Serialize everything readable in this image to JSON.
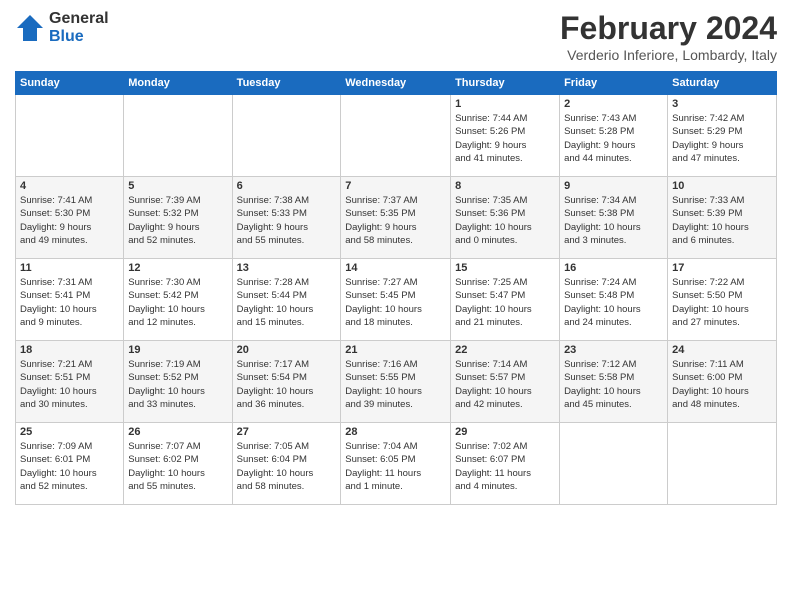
{
  "logo": {
    "general": "General",
    "blue": "Blue"
  },
  "title": "February 2024",
  "subtitle": "Verderio Inferiore, Lombardy, Italy",
  "headers": [
    "Sunday",
    "Monday",
    "Tuesday",
    "Wednesday",
    "Thursday",
    "Friday",
    "Saturday"
  ],
  "weeks": [
    [
      {
        "day": "",
        "info": ""
      },
      {
        "day": "",
        "info": ""
      },
      {
        "day": "",
        "info": ""
      },
      {
        "day": "",
        "info": ""
      },
      {
        "day": "1",
        "info": "Sunrise: 7:44 AM\nSunset: 5:26 PM\nDaylight: 9 hours\nand 41 minutes."
      },
      {
        "day": "2",
        "info": "Sunrise: 7:43 AM\nSunset: 5:28 PM\nDaylight: 9 hours\nand 44 minutes."
      },
      {
        "day": "3",
        "info": "Sunrise: 7:42 AM\nSunset: 5:29 PM\nDaylight: 9 hours\nand 47 minutes."
      }
    ],
    [
      {
        "day": "4",
        "info": "Sunrise: 7:41 AM\nSunset: 5:30 PM\nDaylight: 9 hours\nand 49 minutes."
      },
      {
        "day": "5",
        "info": "Sunrise: 7:39 AM\nSunset: 5:32 PM\nDaylight: 9 hours\nand 52 minutes."
      },
      {
        "day": "6",
        "info": "Sunrise: 7:38 AM\nSunset: 5:33 PM\nDaylight: 9 hours\nand 55 minutes."
      },
      {
        "day": "7",
        "info": "Sunrise: 7:37 AM\nSunset: 5:35 PM\nDaylight: 9 hours\nand 58 minutes."
      },
      {
        "day": "8",
        "info": "Sunrise: 7:35 AM\nSunset: 5:36 PM\nDaylight: 10 hours\nand 0 minutes."
      },
      {
        "day": "9",
        "info": "Sunrise: 7:34 AM\nSunset: 5:38 PM\nDaylight: 10 hours\nand 3 minutes."
      },
      {
        "day": "10",
        "info": "Sunrise: 7:33 AM\nSunset: 5:39 PM\nDaylight: 10 hours\nand 6 minutes."
      }
    ],
    [
      {
        "day": "11",
        "info": "Sunrise: 7:31 AM\nSunset: 5:41 PM\nDaylight: 10 hours\nand 9 minutes."
      },
      {
        "day": "12",
        "info": "Sunrise: 7:30 AM\nSunset: 5:42 PM\nDaylight: 10 hours\nand 12 minutes."
      },
      {
        "day": "13",
        "info": "Sunrise: 7:28 AM\nSunset: 5:44 PM\nDaylight: 10 hours\nand 15 minutes."
      },
      {
        "day": "14",
        "info": "Sunrise: 7:27 AM\nSunset: 5:45 PM\nDaylight: 10 hours\nand 18 minutes."
      },
      {
        "day": "15",
        "info": "Sunrise: 7:25 AM\nSunset: 5:47 PM\nDaylight: 10 hours\nand 21 minutes."
      },
      {
        "day": "16",
        "info": "Sunrise: 7:24 AM\nSunset: 5:48 PM\nDaylight: 10 hours\nand 24 minutes."
      },
      {
        "day": "17",
        "info": "Sunrise: 7:22 AM\nSunset: 5:50 PM\nDaylight: 10 hours\nand 27 minutes."
      }
    ],
    [
      {
        "day": "18",
        "info": "Sunrise: 7:21 AM\nSunset: 5:51 PM\nDaylight: 10 hours\nand 30 minutes."
      },
      {
        "day": "19",
        "info": "Sunrise: 7:19 AM\nSunset: 5:52 PM\nDaylight: 10 hours\nand 33 minutes."
      },
      {
        "day": "20",
        "info": "Sunrise: 7:17 AM\nSunset: 5:54 PM\nDaylight: 10 hours\nand 36 minutes."
      },
      {
        "day": "21",
        "info": "Sunrise: 7:16 AM\nSunset: 5:55 PM\nDaylight: 10 hours\nand 39 minutes."
      },
      {
        "day": "22",
        "info": "Sunrise: 7:14 AM\nSunset: 5:57 PM\nDaylight: 10 hours\nand 42 minutes."
      },
      {
        "day": "23",
        "info": "Sunrise: 7:12 AM\nSunset: 5:58 PM\nDaylight: 10 hours\nand 45 minutes."
      },
      {
        "day": "24",
        "info": "Sunrise: 7:11 AM\nSunset: 6:00 PM\nDaylight: 10 hours\nand 48 minutes."
      }
    ],
    [
      {
        "day": "25",
        "info": "Sunrise: 7:09 AM\nSunset: 6:01 PM\nDaylight: 10 hours\nand 52 minutes."
      },
      {
        "day": "26",
        "info": "Sunrise: 7:07 AM\nSunset: 6:02 PM\nDaylight: 10 hours\nand 55 minutes."
      },
      {
        "day": "27",
        "info": "Sunrise: 7:05 AM\nSunset: 6:04 PM\nDaylight: 10 hours\nand 58 minutes."
      },
      {
        "day": "28",
        "info": "Sunrise: 7:04 AM\nSunset: 6:05 PM\nDaylight: 11 hours\nand 1 minute."
      },
      {
        "day": "29",
        "info": "Sunrise: 7:02 AM\nSunset: 6:07 PM\nDaylight: 11 hours\nand 4 minutes."
      },
      {
        "day": "",
        "info": ""
      },
      {
        "day": "",
        "info": ""
      }
    ]
  ]
}
